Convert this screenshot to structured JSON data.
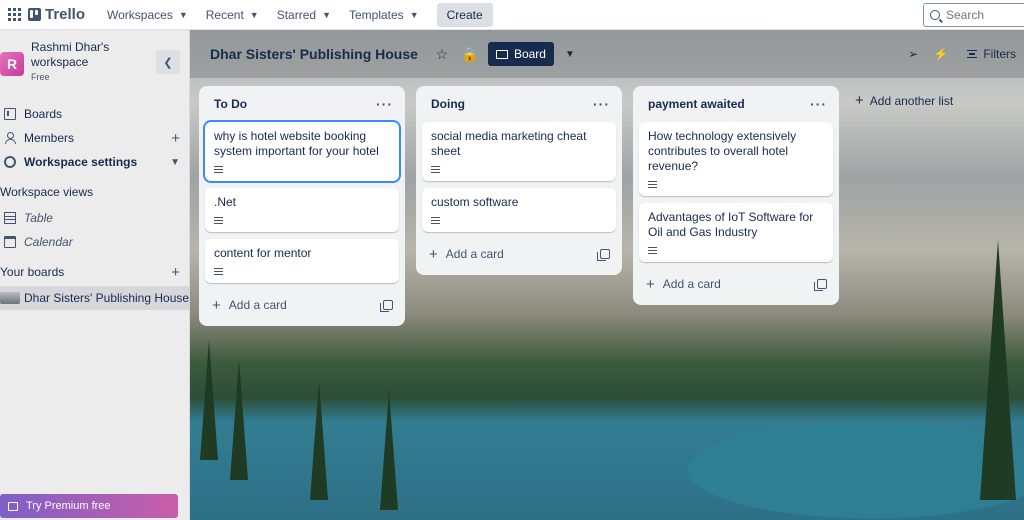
{
  "topbar": {
    "logo": "Trello",
    "nav": [
      "Workspaces",
      "Recent",
      "Starred",
      "Templates"
    ],
    "create": "Create",
    "search_placeholder": "Search"
  },
  "sidebar": {
    "workspace_initial": "R",
    "workspace_name": "Rashmi Dhar's workspace",
    "plan": "Free",
    "items": {
      "boards": "Boards",
      "members": "Members",
      "settings": "Workspace settings"
    },
    "views_heading": "Workspace views",
    "views": [
      "Table",
      "Calendar"
    ],
    "your_boards_heading": "Your boards",
    "board_name": "Dhar Sisters' Publishing House",
    "premium": "Try Premium free"
  },
  "board": {
    "title": "Dhar Sisters' Publishing House",
    "view_label": "Board",
    "filters": "Filters",
    "add_list": "Add another list",
    "lists": [
      {
        "title": "To Do",
        "cards": [
          "why is hotel website booking system important for your hotel",
          ".Net",
          "content for mentor"
        ],
        "add_card": "Add a card"
      },
      {
        "title": "Doing",
        "cards": [
          "social media marketing cheat sheet",
          "custom software"
        ],
        "add_card": "Add a card"
      },
      {
        "title": "payment awaited",
        "cards": [
          "How technology extensively contributes to overall hotel revenue?",
          "Advantages of IoT Software for Oil and Gas Industry"
        ],
        "add_card": "Add a card"
      }
    ]
  },
  "colors": {
    "accent": "#388bff",
    "header_dark": "#172b4d",
    "avatar": "#d9479f"
  }
}
